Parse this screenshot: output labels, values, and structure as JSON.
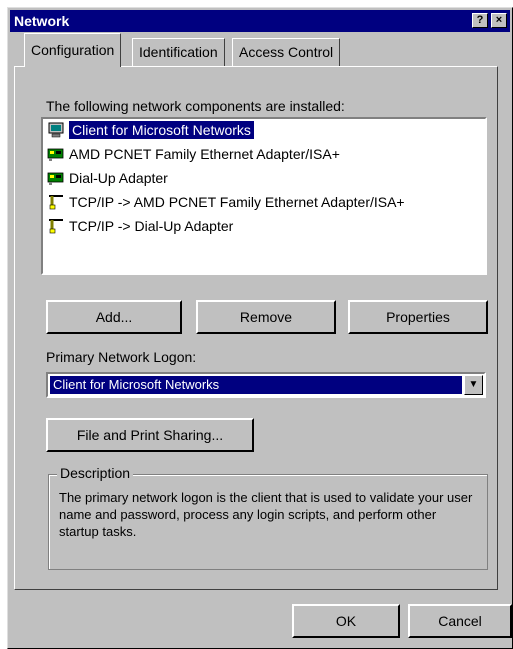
{
  "window": {
    "title": "Network",
    "help_glyph": "?",
    "close_glyph": "×"
  },
  "tabs": [
    {
      "label": "Configuration",
      "active": true
    },
    {
      "label": "Identification",
      "active": false
    },
    {
      "label": "Access Control",
      "active": false
    }
  ],
  "components": {
    "heading": "The following network components are installed:",
    "items": [
      {
        "label": "Client for Microsoft Networks",
        "icon": "client-icon",
        "selected": true
      },
      {
        "label": "AMD PCNET Family Ethernet Adapter/ISA+",
        "icon": "adapter-icon",
        "selected": false
      },
      {
        "label": "Dial-Up Adapter",
        "icon": "adapter-icon",
        "selected": false
      },
      {
        "label": "TCP/IP -> AMD PCNET Family Ethernet Adapter/ISA+",
        "icon": "protocol-icon",
        "selected": false
      },
      {
        "label": "TCP/IP -> Dial-Up Adapter",
        "icon": "protocol-icon",
        "selected": false
      }
    ]
  },
  "buttons": {
    "add": "Add...",
    "remove": "Remove",
    "properties": "Properties"
  },
  "logon": {
    "label": "Primary Network Logon:",
    "value": "Client for Microsoft Networks"
  },
  "file_print_button": "File and Print Sharing...",
  "description": {
    "legend": "Description",
    "text": "The primary network logon is the client that is used to validate your user name and password, process any login scripts, and perform other startup tasks."
  },
  "footer": {
    "ok": "OK",
    "cancel": "Cancel"
  },
  "colors": {
    "face": "#c0c0c0",
    "titlebar": "#000080",
    "selection": "#000080"
  }
}
